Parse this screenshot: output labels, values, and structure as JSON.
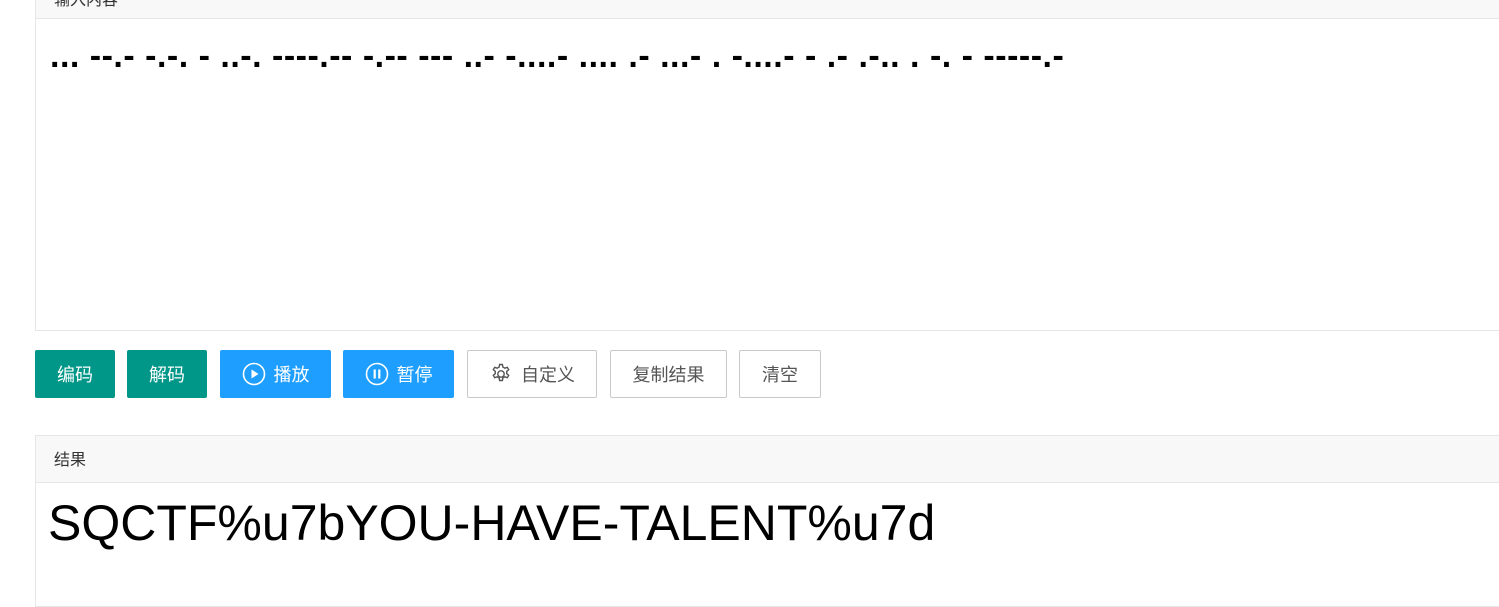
{
  "input_panel": {
    "header": "输入内容",
    "text": "... --.- -.-. - ..-. ----.-- -.-- --- ..- -....- .... .- ...- . -....- - .- .-.. . -. - -----.-"
  },
  "buttons": {
    "encode": "编码",
    "decode": "解码",
    "play": "播放",
    "pause": "暂停",
    "custom": "自定义",
    "copy_result": "复制结果",
    "clear": "清空"
  },
  "icons": {
    "play": "play-circle-icon",
    "pause": "pause-circle-icon",
    "custom": "gear-icon"
  },
  "colors": {
    "green": "#009688",
    "blue": "#1e9fff",
    "border": "#c9c9c9",
    "header_bg": "#f8f8f8"
  },
  "result_panel": {
    "header": "结果",
    "text": "SQCTF%u7bYOU-HAVE-TALENT%u7d"
  }
}
